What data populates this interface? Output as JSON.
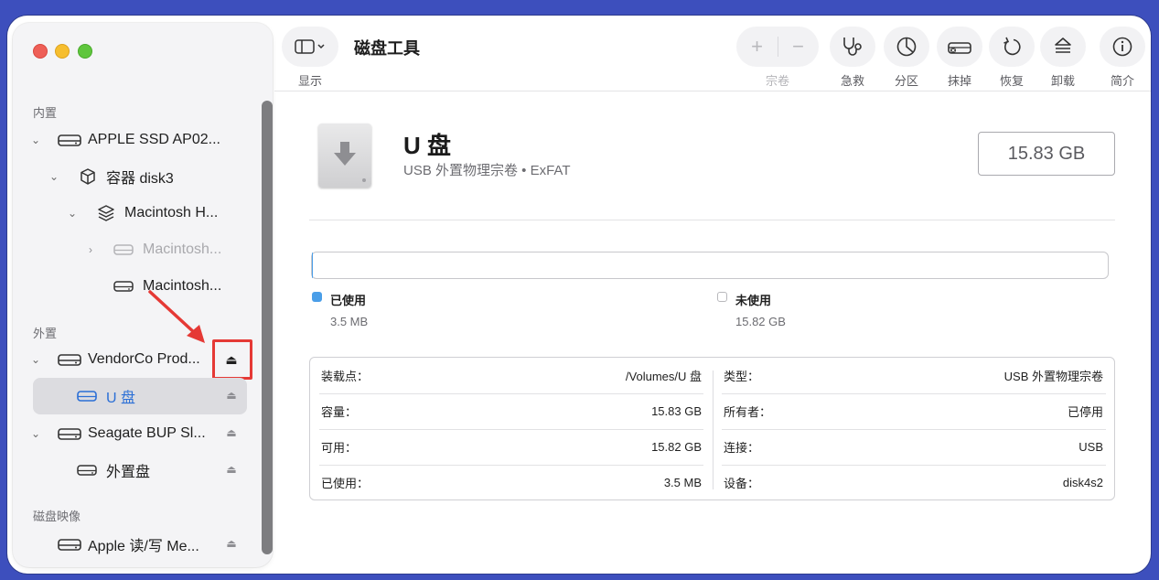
{
  "app": {
    "title": "磁盘工具"
  },
  "toolbar": {
    "view_label": "显示",
    "volume_label": "宗卷",
    "first_aid_label": "急救",
    "partition_label": "分区",
    "erase_label": "抹掉",
    "restore_label": "恢复",
    "unmount_label": "卸载",
    "info_label": "简介"
  },
  "sidebar": {
    "internal_label": "内置",
    "external_label": "外置",
    "images_label": "磁盘映像",
    "items": [
      {
        "label": "APPLE SSD AP02..."
      },
      {
        "label": "容器 disk3"
      },
      {
        "label": "Macintosh H..."
      },
      {
        "label": "Macintosh..."
      },
      {
        "label": "Macintosh..."
      },
      {
        "label": "VendorCo Prod..."
      },
      {
        "label": "U 盘"
      },
      {
        "label": "Seagate BUP Sl..."
      },
      {
        "label": "外置盘"
      },
      {
        "label": "Apple 读/写 Me..."
      }
    ]
  },
  "volume": {
    "name": "U 盘",
    "subtitle": "USB 外置物理宗卷 • ExFAT",
    "size": "15.83 GB",
    "used_fraction": 0.0002,
    "used_label": "已使用",
    "used_value": "3.5 MB",
    "free_label": "未使用",
    "free_value": "15.82 GB"
  },
  "colors": {
    "used": "#4a9ee8",
    "accent": "#2b6fd6",
    "annotation": "#e53935"
  },
  "info": {
    "left": [
      {
        "key": "装载点：",
        "value": "/Volumes/U 盘"
      },
      {
        "key": "容量：",
        "value": "15.83 GB"
      },
      {
        "key": "可用：",
        "value": "15.82 GB"
      },
      {
        "key": "已使用：",
        "value": "3.5 MB"
      }
    ],
    "right": [
      {
        "key": "类型：",
        "value": "USB 外置物理宗卷"
      },
      {
        "key": "所有者：",
        "value": "已停用"
      },
      {
        "key": "连接：",
        "value": "USB"
      },
      {
        "key": "设备：",
        "value": "disk4s2"
      }
    ]
  }
}
